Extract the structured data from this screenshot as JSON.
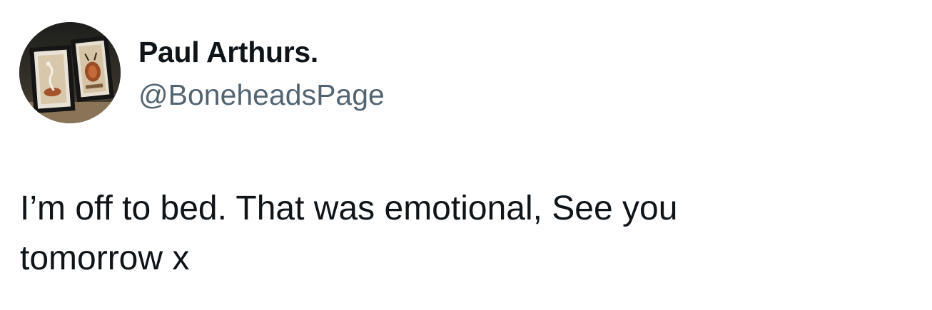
{
  "author": {
    "display_name": "Paul Arthurs.",
    "handle": "@BoneheadsPage",
    "avatar_icon": "framed-pictures-avatar"
  },
  "tweet": {
    "text": "I’m off to bed. That was emotional, See you tomorrow x"
  }
}
